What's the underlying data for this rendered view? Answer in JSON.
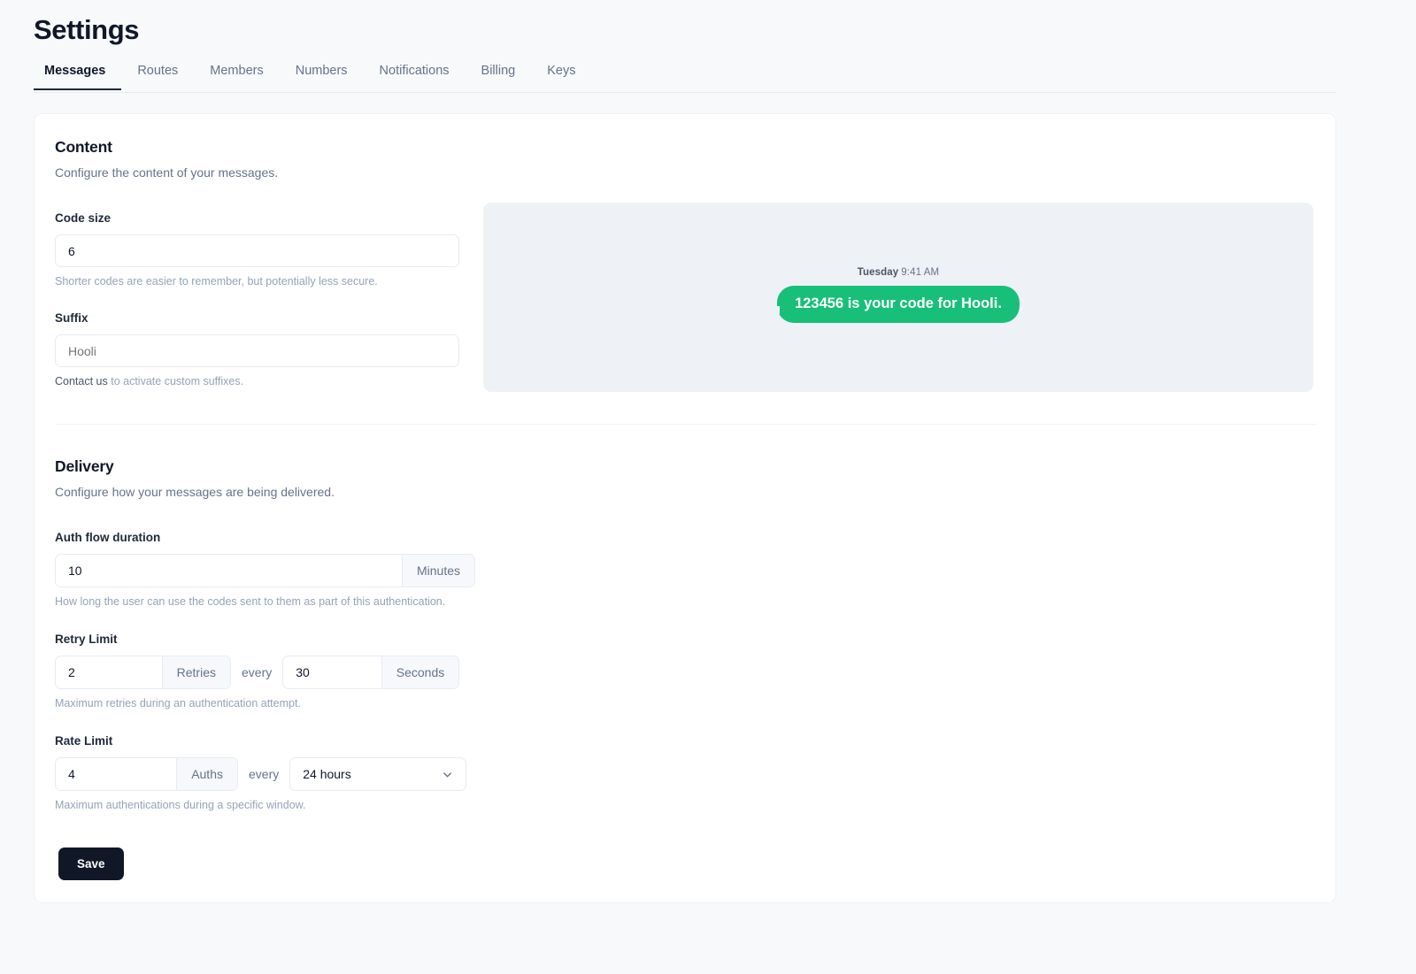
{
  "header": {
    "title": "Settings",
    "tabs": [
      {
        "label": "Messages",
        "active": true
      },
      {
        "label": "Routes",
        "active": false
      },
      {
        "label": "Members",
        "active": false
      },
      {
        "label": "Numbers",
        "active": false
      },
      {
        "label": "Notifications",
        "active": false
      },
      {
        "label": "Billing",
        "active": false
      },
      {
        "label": "Keys",
        "active": false
      }
    ]
  },
  "content": {
    "title": "Content",
    "subtitle": "Configure the content of your messages.",
    "code_size": {
      "label": "Code size",
      "value": "6",
      "help": "Shorter codes are easier to remember, but potentially less secure."
    },
    "suffix": {
      "label": "Suffix",
      "placeholder": "Hooli",
      "value": "",
      "help_link": "Contact us",
      "help_rest": " to activate custom suffixes."
    },
    "preview": {
      "day": "Tuesday",
      "time": "9:41 AM",
      "message": "123456 is your code for Hooli.",
      "bubble_color": "#18bf78",
      "panel_color": "#eef2f7"
    }
  },
  "delivery": {
    "title": "Delivery",
    "subtitle": "Configure how your messages are being delivered.",
    "auth_flow": {
      "label": "Auth flow duration",
      "value": "10",
      "unit": "Minutes",
      "help": "How long the user can use the codes sent to them as part of this authentication."
    },
    "retry_limit": {
      "label": "Retry Limit",
      "count_value": "2",
      "count_unit": "Retries",
      "separator": "every",
      "window_value": "30",
      "window_unit": "Seconds",
      "help": "Maximum retries during an authentication attempt."
    },
    "rate_limit": {
      "label": "Rate Limit",
      "count_value": "4",
      "count_unit": "Auths",
      "separator": "every",
      "window_selected": "24 hours",
      "window_icon": "chevron-down-icon",
      "help": "Maximum authentications during a specific window."
    }
  },
  "actions": {
    "save_label": "Save"
  }
}
